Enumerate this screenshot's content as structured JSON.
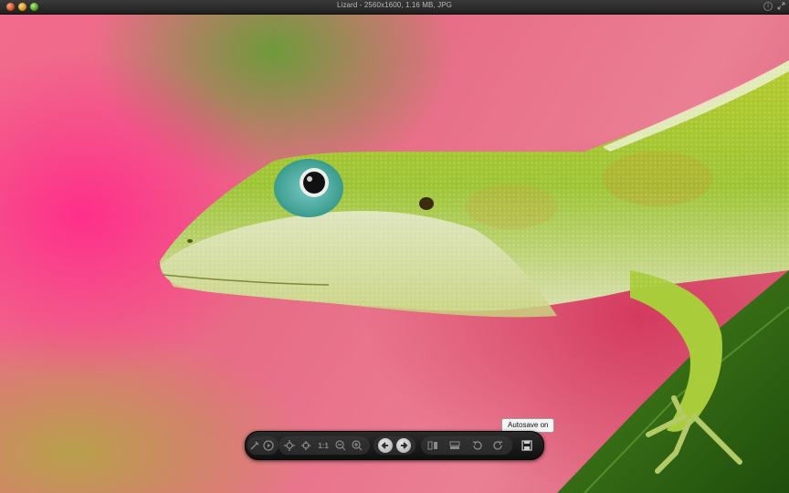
{
  "window": {
    "title": "Lizard - 2560x1600, 1.16 MB, JPG"
  },
  "viewer": {
    "image_subject": "green anole lizard on pink background"
  },
  "toolbar": {
    "zoom_one_to_one_label": "1:1",
    "tooltip": "Autosave on",
    "buttons": [
      "rotate-tool-icon",
      "slideshow-play-icon",
      "zoom-fit-icon",
      "zoom-fill-icon",
      "actual-size",
      "zoom-out-icon",
      "zoom-in-icon",
      "previous-arrow-icon",
      "next-arrow-icon",
      "side-by-side-icon",
      "thumbnails-icon",
      "rotate-left-icon",
      "rotate-right-icon",
      "autosave-icon"
    ]
  },
  "colors": {
    "titlebar": "#2a2a2a",
    "toolbar": "#1b1b1b",
    "lizard_green": "#8cc63a",
    "background_pink": "#ee6a8a"
  }
}
